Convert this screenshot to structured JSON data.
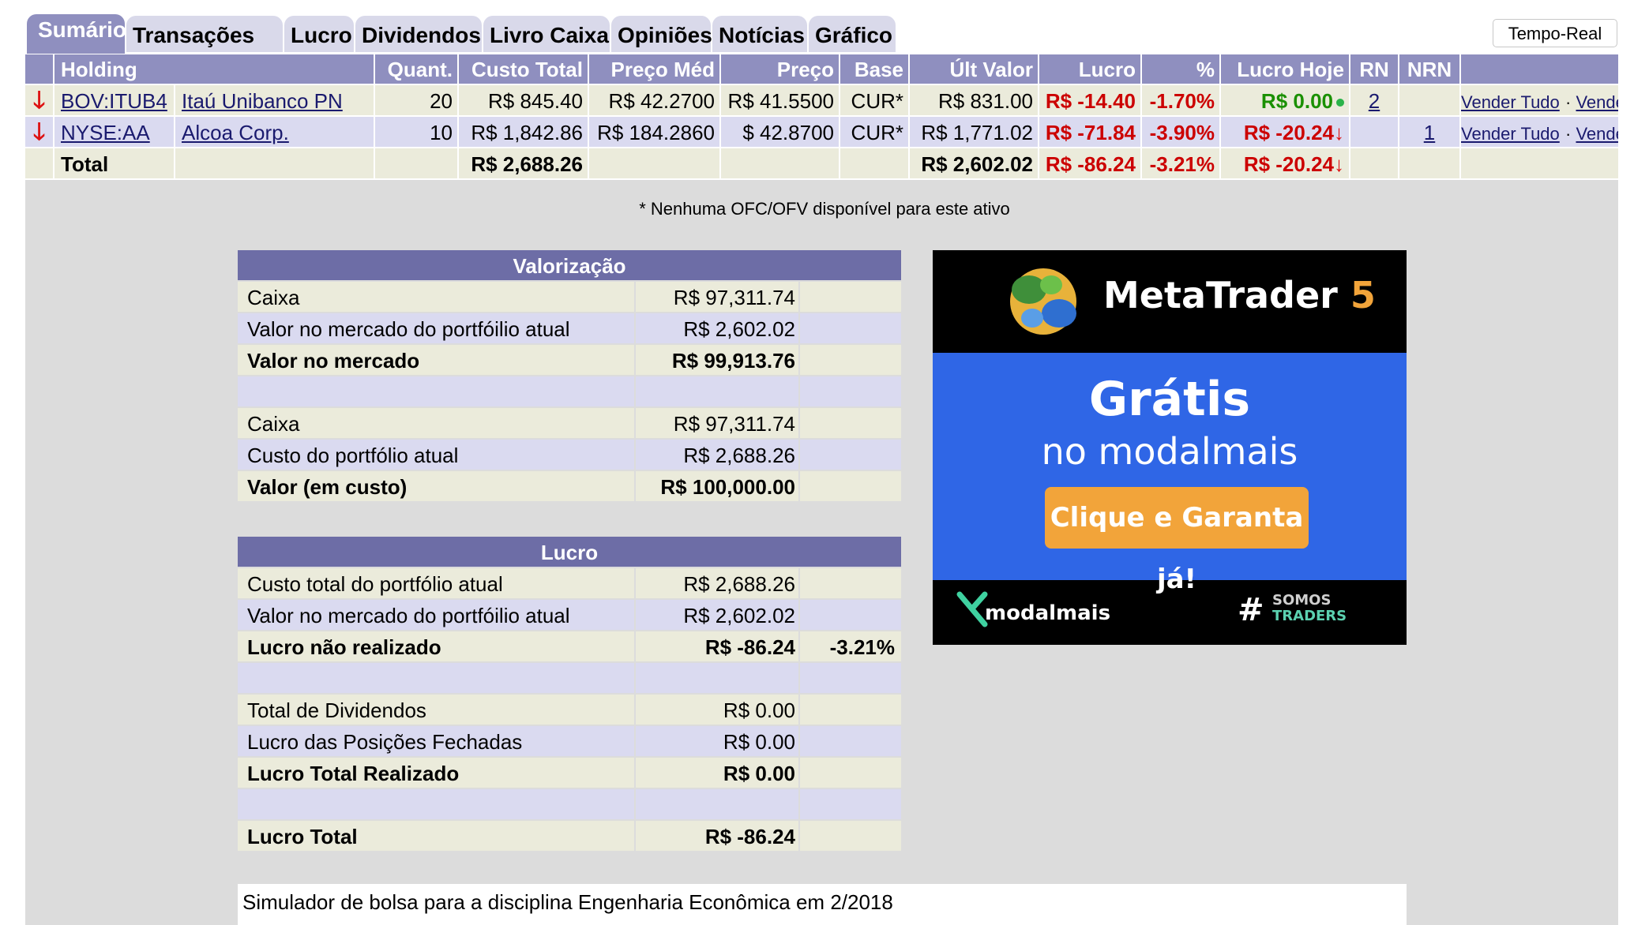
{
  "tabs": [
    {
      "label": "Sumário",
      "active": true
    },
    {
      "label": "Transações"
    },
    {
      "label": "Lucro"
    },
    {
      "label": "Dividendos"
    },
    {
      "label": "Livro Caixa"
    },
    {
      "label": "Opiniões"
    },
    {
      "label": "Notícias"
    },
    {
      "label": "Gráfico"
    }
  ],
  "realtime_button": "Tempo-Real",
  "holdings": {
    "headers": [
      "Holding",
      "Quant.",
      "Custo Total",
      "Preço Méd",
      "Preço",
      "Base",
      "Últ Valor",
      "Lucro",
      "%",
      "Lucro Hoje",
      "RN",
      "NRN"
    ],
    "rows": [
      {
        "symbol": "BOV:ITUB4",
        "name": "Itaú Unibanco PN",
        "qty": "20",
        "cost_total": "R$ 845.40",
        "avg_price": "R$ 42.2700",
        "price": "R$ 41.5500",
        "base": "CUR*",
        "last_value": "R$ 831.00",
        "profit": "R$ -14.40",
        "pct": "-1.70%",
        "profit_today": "R$ 0.00",
        "rn": "2",
        "nrn": "",
        "sell_all": "Vender Tudo",
        "sell": "Vender"
      },
      {
        "symbol": "NYSE:AA",
        "name": "Alcoa Corp.",
        "qty": "10",
        "cost_total": "R$ 1,842.86",
        "avg_price": "R$ 184.2860",
        "price": "$ 42.8700",
        "base": "CUR*",
        "last_value": "R$ 1,771.02",
        "profit": "R$ -71.84",
        "pct": "-3.90%",
        "profit_today": "R$ -20.24",
        "rn": "",
        "nrn": "1",
        "sell_all": "Vender Tudo",
        "sell": "Vender"
      }
    ],
    "total": {
      "label": "Total",
      "cost_total": "R$ 2,688.26",
      "last_value": "R$ 2,602.02",
      "profit": "R$ -86.24",
      "pct": "-3.21%",
      "profit_today": "R$ -20.24"
    }
  },
  "note": "* Nenhuma OFC/OFV disponível para este ativo",
  "valorizacao": {
    "title": "Valorização",
    "rows": [
      {
        "label": "Caixa",
        "value": "R$ 97,311.74",
        "extra": ""
      },
      {
        "label": "Valor no mercado do portfóilio atual",
        "value": "R$ 2,602.02",
        "extra": ""
      },
      {
        "label": "Valor no mercado",
        "value": "R$ 99,913.76",
        "extra": ""
      },
      {
        "label": "",
        "value": "",
        "extra": ""
      },
      {
        "label": "Caixa",
        "value": "R$ 97,311.74",
        "extra": ""
      },
      {
        "label": "Custo do portfólio atual",
        "value": "R$ 2,688.26",
        "extra": ""
      },
      {
        "label": "Valor (em custo)",
        "value": "R$ 100,000.00",
        "extra": ""
      }
    ]
  },
  "lucro": {
    "title": "Lucro",
    "rows": [
      {
        "label": "Custo total do portfólio atual",
        "value": "R$ 2,688.26",
        "extra": ""
      },
      {
        "label": "Valor no mercado do portfóilio atual",
        "value": "R$ 2,602.02",
        "extra": ""
      },
      {
        "label": "Lucro não realizado",
        "value": "R$ -86.24",
        "extra": "-3.21%"
      },
      {
        "label": "",
        "value": "",
        "extra": ""
      },
      {
        "label": "Total de Dividendos",
        "value": "R$ 0.00",
        "extra": ""
      },
      {
        "label": "Lucro das Posições Fechadas",
        "value": "R$ 0.00",
        "extra": ""
      },
      {
        "label": "Lucro Total Realizado",
        "value": "R$ 0.00",
        "extra": ""
      },
      {
        "label": "",
        "value": "",
        "extra": ""
      },
      {
        "label": "Lucro Total",
        "value": "R$ -86.24",
        "extra": ""
      }
    ]
  },
  "ad": {
    "brand": "MetaTrader",
    "brand_num": "5",
    "headline": "Grátis",
    "subheadline": "no modalmais",
    "cta": "Clique e Garanta já!",
    "footer_left": "modalmais",
    "footer_hash": "#",
    "footer_right_1": "SOMOS",
    "footer_right_2": "TRADERS"
  },
  "footer_text": "Simulador de bolsa para a disciplina Engenharia Econômica em 2/2018",
  "colors": {
    "header": "#8f8fbf",
    "title_bar": "#6d6da6",
    "row_a": "#ebebdb",
    "row_b": "#dadaf0",
    "loss": "#cc0000",
    "gain": "#1a9000",
    "ad_blue": "#2f66e6",
    "ad_orange": "#f2a43a"
  }
}
